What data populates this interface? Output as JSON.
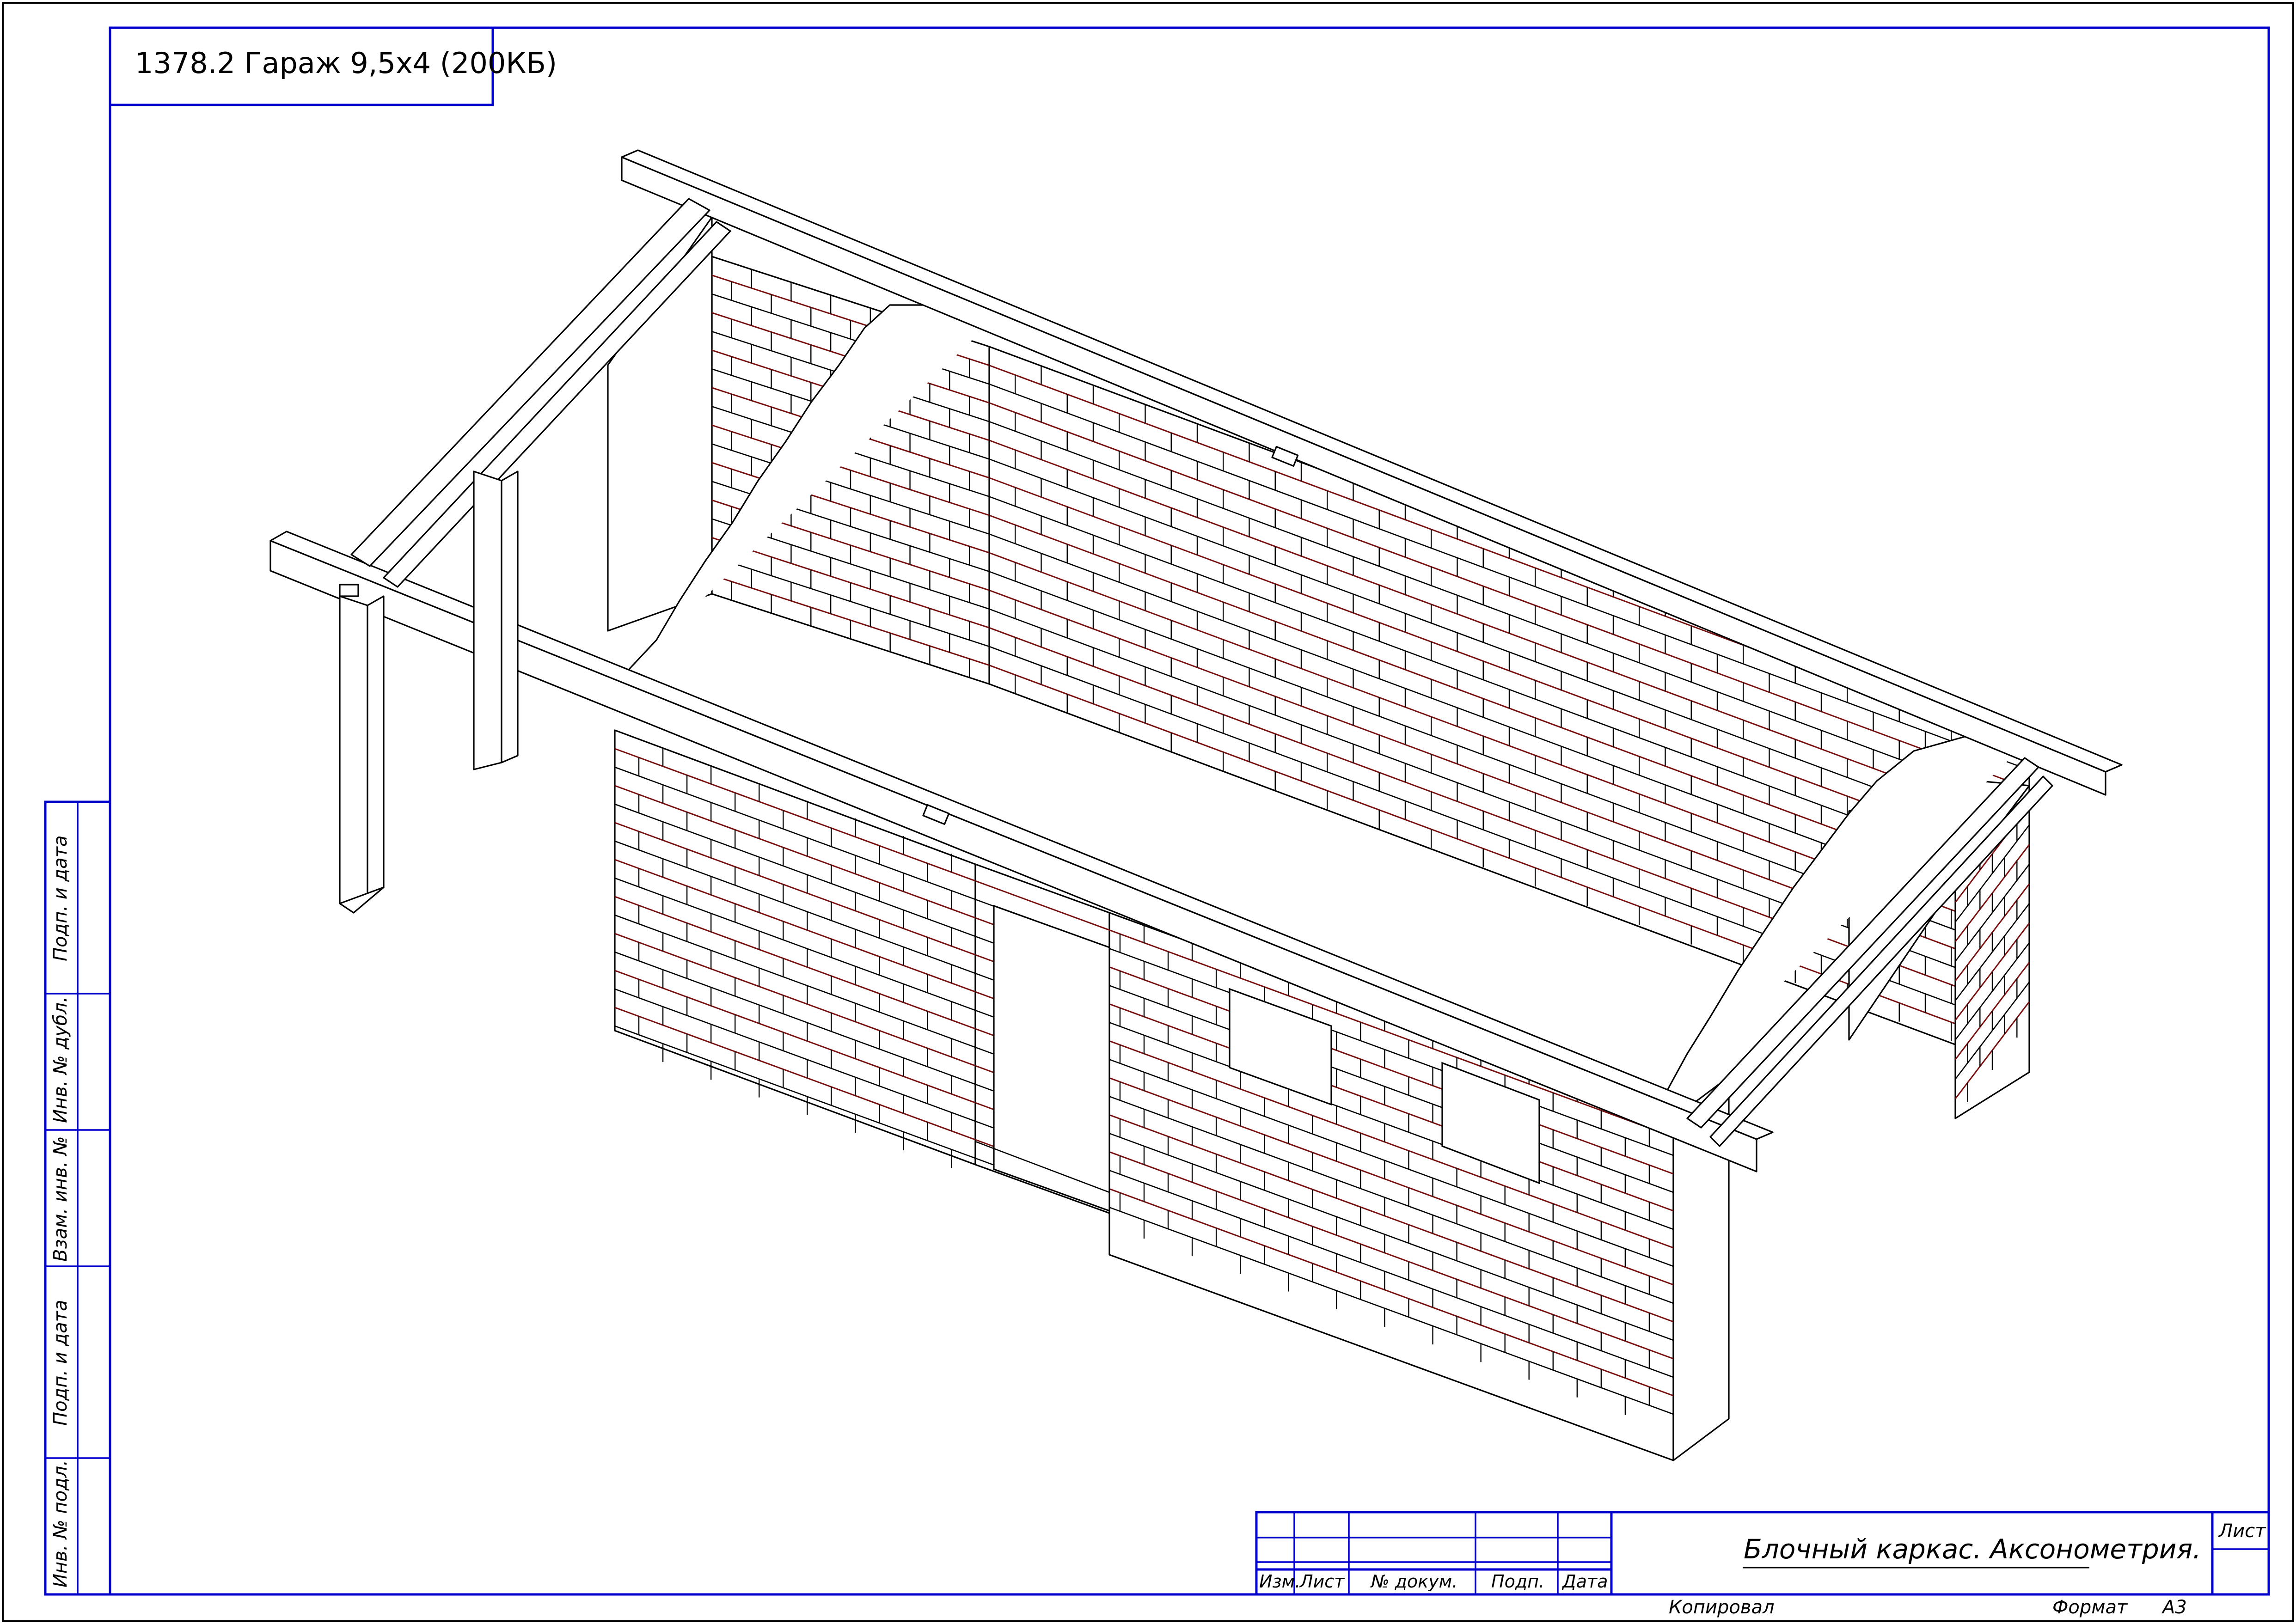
{
  "header": {
    "title": "1378.2 Гараж 9,5х4 (200КБ)"
  },
  "title_block": {
    "sheet_title": "Блочный каркас. Аксонометрия.",
    "columns": [
      "Изм.",
      "Лист",
      "№ докум.",
      "Подп.",
      "Дата"
    ],
    "sheet_label": "Лист",
    "copied_label": "Копировал",
    "format_label": "Формат",
    "format_value": "А3"
  },
  "side_stamp": [
    "Подп. и дата",
    "Инв. № дубл.",
    "Взам. инв. №",
    "Подп. и дата",
    "Инв. № подл."
  ],
  "colors": {
    "frame": "#0000cc",
    "line": "#000000",
    "mortar": "#7a1010",
    "paper": "#ffffff"
  }
}
